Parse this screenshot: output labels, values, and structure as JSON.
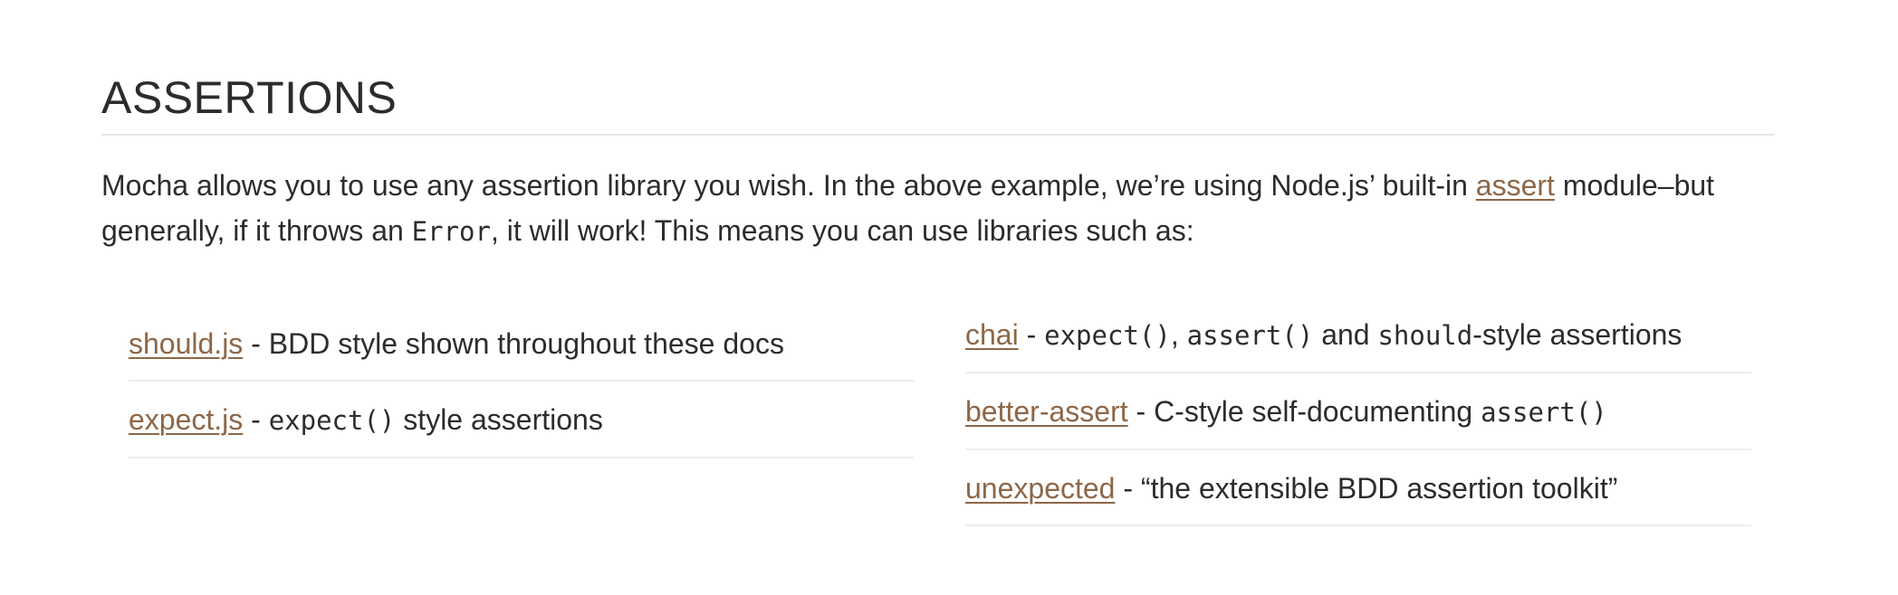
{
  "section": {
    "heading": "ASSERTIONS",
    "intro": {
      "part1": "Mocha allows you to use any assertion library you wish. In the above example, we’re using Node.js’ built-in ",
      "assert_link": "assert",
      "part2": " module–but generally, if it throws an ",
      "error_code": "Error",
      "part3": ", it will work! This means you can use libraries such as:"
    }
  },
  "libraries_left": [
    {
      "name": "should.js",
      "desc": " - BDD style shown throughout these docs"
    },
    {
      "name": "expect.js",
      "desc_prefix": " - ",
      "code": "expect()",
      "desc_suffix": " style assertions"
    }
  ],
  "libraries_right": [
    {
      "name": "chai",
      "sep": " - ",
      "code1": "expect()",
      "comma": ", ",
      "code2": "assert()",
      "and_text": " and ",
      "code3": "should",
      "suffix": "-style assertions"
    },
    {
      "name": "better-assert",
      "desc_prefix": " - C-style self-documenting ",
      "code": "assert()"
    },
    {
      "name": "unexpected",
      "desc": " - “the extensible BDD assertion toolkit”"
    }
  ],
  "colors": {
    "link": "#8d6748",
    "text": "#2c2c2c",
    "divider": "#e6e6e6"
  }
}
